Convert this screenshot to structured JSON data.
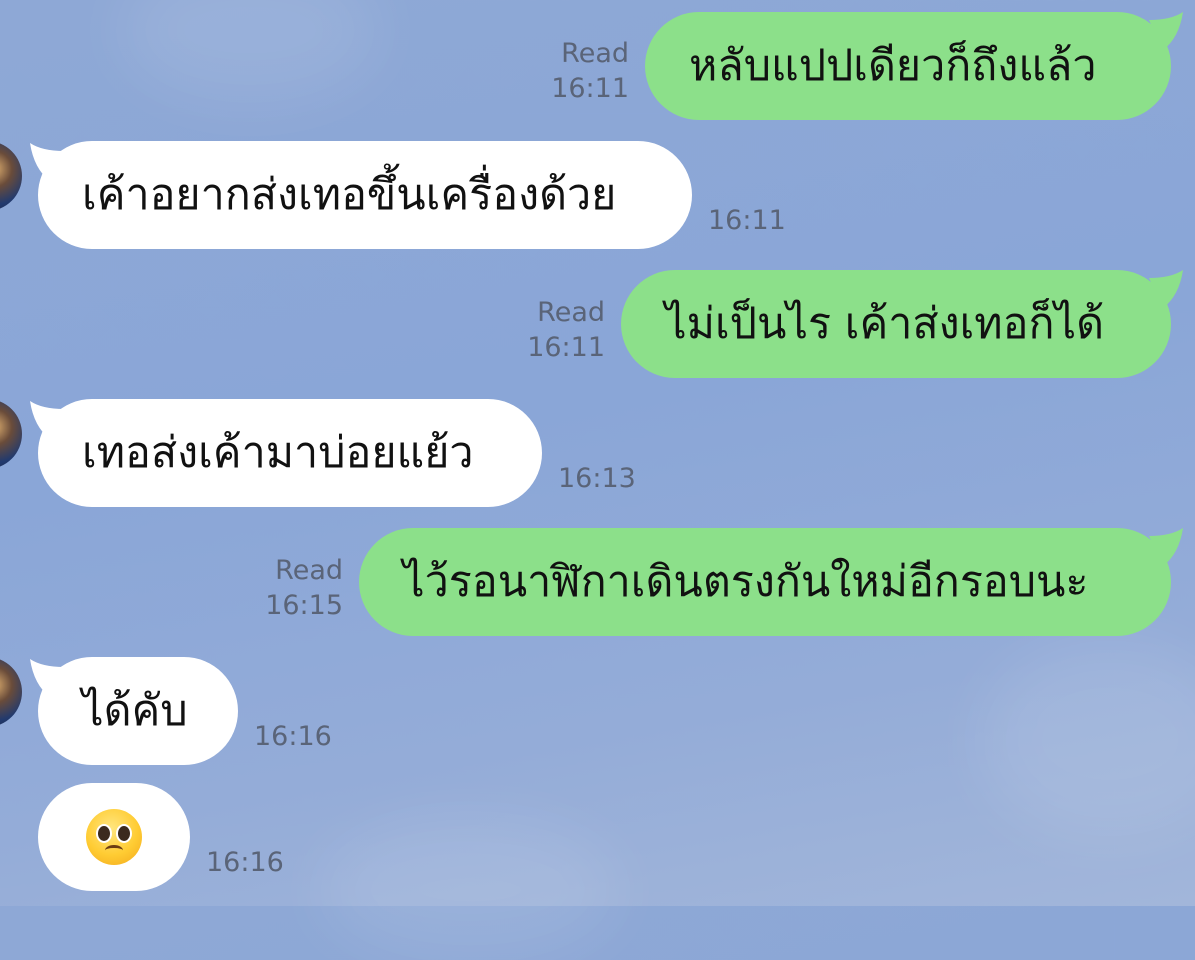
{
  "messages": [
    {
      "direction": "outgoing",
      "text": "หลับแปปเดียวก็ถึงแล้ว",
      "read_label": "Read",
      "time": "16:11"
    },
    {
      "direction": "incoming",
      "text": "เค้าอยากส่งเทอขึ้นเครื่องด้วย",
      "time": "16:11",
      "avatar": true
    },
    {
      "direction": "outgoing",
      "text": "ไม่เป็นไร เค้าส่งเทอก็ได้",
      "read_label": "Read",
      "time": "16:11"
    },
    {
      "direction": "incoming",
      "text": "เทอส่งเค้ามาบ่อยแย้ว",
      "time": "16:13",
      "avatar": true
    },
    {
      "direction": "outgoing",
      "text": "ไว้รอนาฬิกาเดินตรงกันใหม่อีกรอบนะ",
      "read_label": "Read",
      "time": "16:15"
    },
    {
      "direction": "incoming",
      "text": "ได้คับ",
      "time": "16:16",
      "avatar": true
    },
    {
      "direction": "incoming",
      "emoji": "pleading-face",
      "time": "16:16",
      "avatar": false
    }
  ],
  "colors": {
    "background": "#8ea8d6",
    "outgoing_bubble": "#8ce08a",
    "incoming_bubble": "#ffffff",
    "meta_text": "#5a6478"
  }
}
